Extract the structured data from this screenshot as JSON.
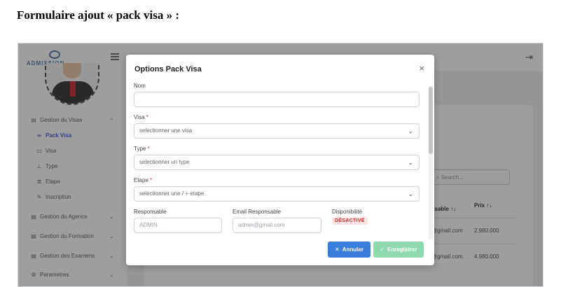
{
  "doc": {
    "heading": "Formulaire ajout « pack visa » :"
  },
  "app": {
    "logo_text": "ADMISSION",
    "sidebar": [
      {
        "label": "Gestion du Visas",
        "icon": "building-icon",
        "chevron": "⌃"
      },
      {
        "label": "Pack Visa",
        "icon": "link-icon",
        "active": true
      },
      {
        "label": "Visa",
        "icon": "card-icon"
      },
      {
        "label": "Type",
        "icon": "hierarchy-icon"
      },
      {
        "label": "Etape",
        "icon": "list-icon"
      },
      {
        "label": "Inscription",
        "icon": "pen-icon"
      },
      {
        "label": "Gestion du Agence",
        "icon": "building-icon",
        "chevron": "⌄"
      },
      {
        "label": "Gestion du Formation",
        "icon": "building-icon",
        "chevron": "⌄"
      },
      {
        "label": "Gestion des Examens",
        "icon": "building-icon",
        "chevron": "⌄"
      },
      {
        "label": "Parametres",
        "icon": "gear-icon",
        "chevron": "⌄"
      }
    ],
    "background_table": {
      "search_placeholder": "Search...",
      "headers": [
        "esable ↑↓",
        "Prix ↑↓"
      ],
      "rows": [
        [
          "@gmail.com",
          "2.980.000"
        ],
        [
          "@gmail.com",
          "4.980.000"
        ]
      ]
    }
  },
  "modal": {
    "title": "Options Pack Visa",
    "close_glyph": "×",
    "nom": {
      "label": "Nom",
      "value": ""
    },
    "visa": {
      "label": "Visa",
      "required_mark": "*",
      "placeholder": "selectionner une visa"
    },
    "type": {
      "label": "Type",
      "required_mark": "*",
      "placeholder": "selectionner un type"
    },
    "etape": {
      "label": "Etape",
      "required_mark": "*",
      "placeholder": "selectionner une / + etape"
    },
    "responsable": {
      "label": "Responsable",
      "value": "ADMIN"
    },
    "email": {
      "label": "Email Responsable",
      "value": "admin@gmail.com"
    },
    "disponibilite": {
      "label": "Disponibilité",
      "badge": "DÉSACTIVÉ",
      "badge_color": "#d32f2f"
    },
    "cancel_label": "Annuler",
    "save_label": "Enregistrer",
    "cancel_color": "#3b7ddd",
    "save_color": "#8ed9b0"
  }
}
